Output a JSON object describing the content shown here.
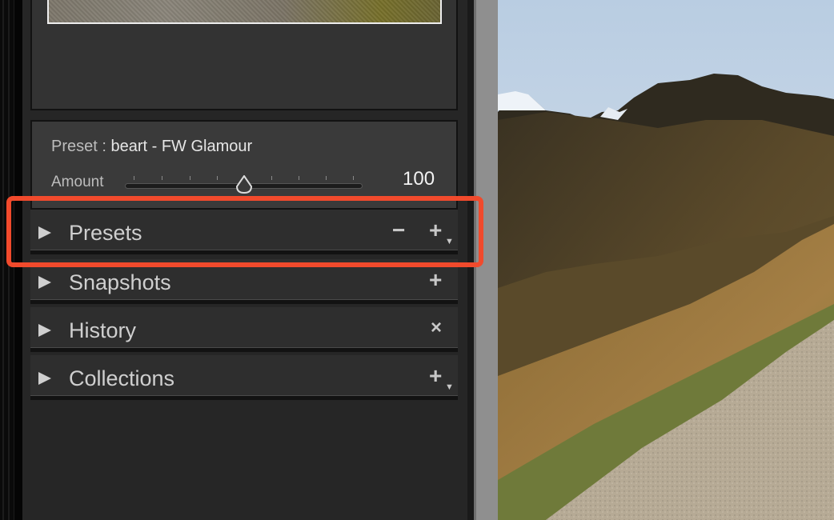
{
  "preset": {
    "label": "Preset :",
    "value": "beart - FW Glamour",
    "amount_label": "Amount",
    "amount_value": "100"
  },
  "sections": [
    {
      "label": "Presets",
      "actions": [
        "−",
        "+"
      ]
    },
    {
      "label": "Snapshots",
      "actions": [
        "+"
      ]
    },
    {
      "label": "History",
      "actions": [
        "×"
      ]
    },
    {
      "label": "Collections",
      "actions": [
        "+"
      ]
    }
  ],
  "colors": {
    "highlight": "#f14a2c",
    "panel": "#262626",
    "text": "#cfcfcf"
  }
}
